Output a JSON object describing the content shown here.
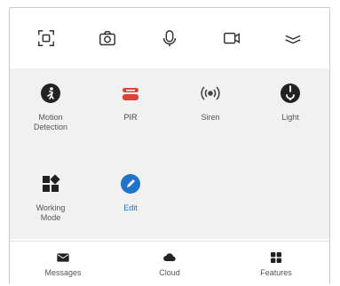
{
  "toolbar": {
    "icons": [
      "screenshot-icon",
      "camera-icon",
      "microphone-icon",
      "video-record-icon",
      "collapse-icon"
    ]
  },
  "features": [
    {
      "label": "Motion\nDetection",
      "icon": "motion-icon",
      "color": "#222222"
    },
    {
      "label": "PIR",
      "icon": "pir-sensor-icon",
      "color": "#e0403a"
    },
    {
      "label": "Siren",
      "icon": "siren-icon",
      "color": "#444444"
    },
    {
      "label": "Light",
      "icon": "light-icon",
      "color": "#222222"
    },
    {
      "label": "Working\nMode",
      "icon": "working-mode-icon",
      "color": "#222222"
    },
    {
      "label": "Edit",
      "icon": "edit-icon",
      "color": "#1f73c8"
    }
  ],
  "tabs": [
    {
      "label": "Messages",
      "icon": "messages-icon"
    },
    {
      "label": "Cloud",
      "icon": "cloud-icon"
    },
    {
      "label": "Features",
      "icon": "features-icon"
    }
  ]
}
